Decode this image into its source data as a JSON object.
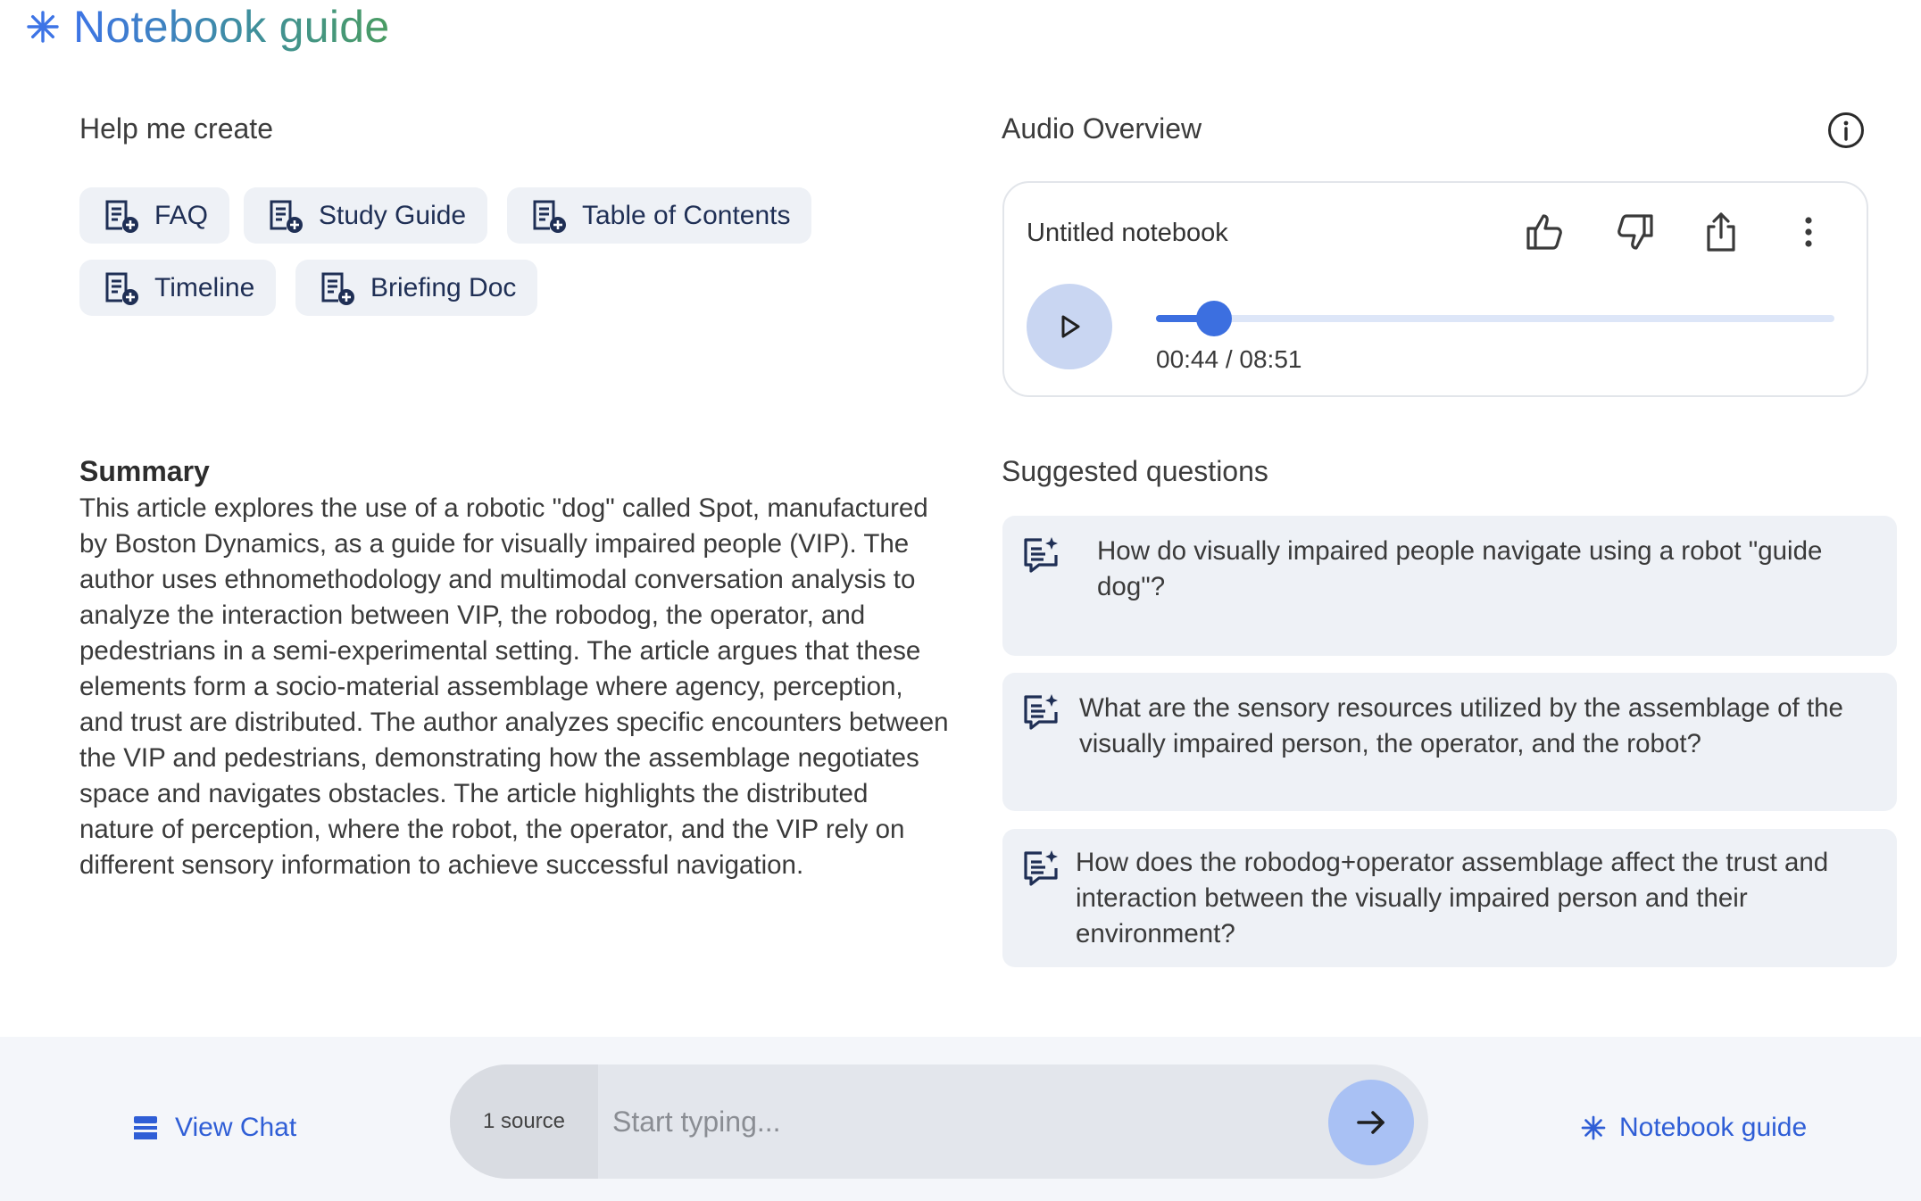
{
  "header": {
    "title": "Notebook guide",
    "icon": "spark-icon"
  },
  "help": {
    "title": "Help me create",
    "chips": [
      {
        "label": "FAQ",
        "icon": "note-add-icon"
      },
      {
        "label": "Study Guide",
        "icon": "note-add-icon"
      },
      {
        "label": "Table of Contents",
        "icon": "note-add-icon"
      },
      {
        "label": "Timeline",
        "icon": "note-add-icon"
      },
      {
        "label": "Briefing Doc",
        "icon": "note-add-icon"
      }
    ]
  },
  "summary": {
    "title": "Summary",
    "text": "This article explores the use of a robotic \"dog\" called Spot, manufactured by Boston Dynamics, as a guide for visually impaired people (VIP). The author uses ethnomethodology and multimodal conversation analysis to analyze the interaction between VIP, the robodog, the operator, and pedestrians in a semi-experimental setting. The article argues that these elements form a socio-material assemblage where agency, perception, and trust are distributed. The author analyzes specific encounters between the VIP and pedestrians, demonstrating how the assemblage negotiates space and navigates obstacles. The article highlights the distributed nature of perception, where the robot, the operator, and the VIP rely on different sensory information to achieve successful navigation."
  },
  "audio": {
    "title": "Audio Overview",
    "notebook_name": "Untitled notebook",
    "time": "00:44 / 08:51",
    "progress": 0.0861,
    "actions": [
      "thumbs-up-icon",
      "thumbs-down-icon",
      "share-icon",
      "more-vert-icon"
    ]
  },
  "suggested": {
    "title": "Suggested questions",
    "questions": [
      {
        "text": "How do visually impaired people navigate using a robot \"guide dog\"?"
      },
      {
        "text": "What are the sensory resources utilized by the assemblage of the visually impaired person, the operator, and the robot?"
      },
      {
        "text": "How does the robodog+operator assemblage affect the trust and interaction between the visually impaired person and their environment?"
      }
    ]
  },
  "bottom": {
    "view_chat": "View Chat",
    "source_count": "1 source",
    "placeholder": "Start typing...",
    "notebook_guide": "Notebook guide"
  },
  "colors": {
    "accent": "#2f5ed6",
    "chip_bg": "#eef1f6",
    "play_bg": "#c9d6f2",
    "send_bg": "#a9c1f4"
  }
}
